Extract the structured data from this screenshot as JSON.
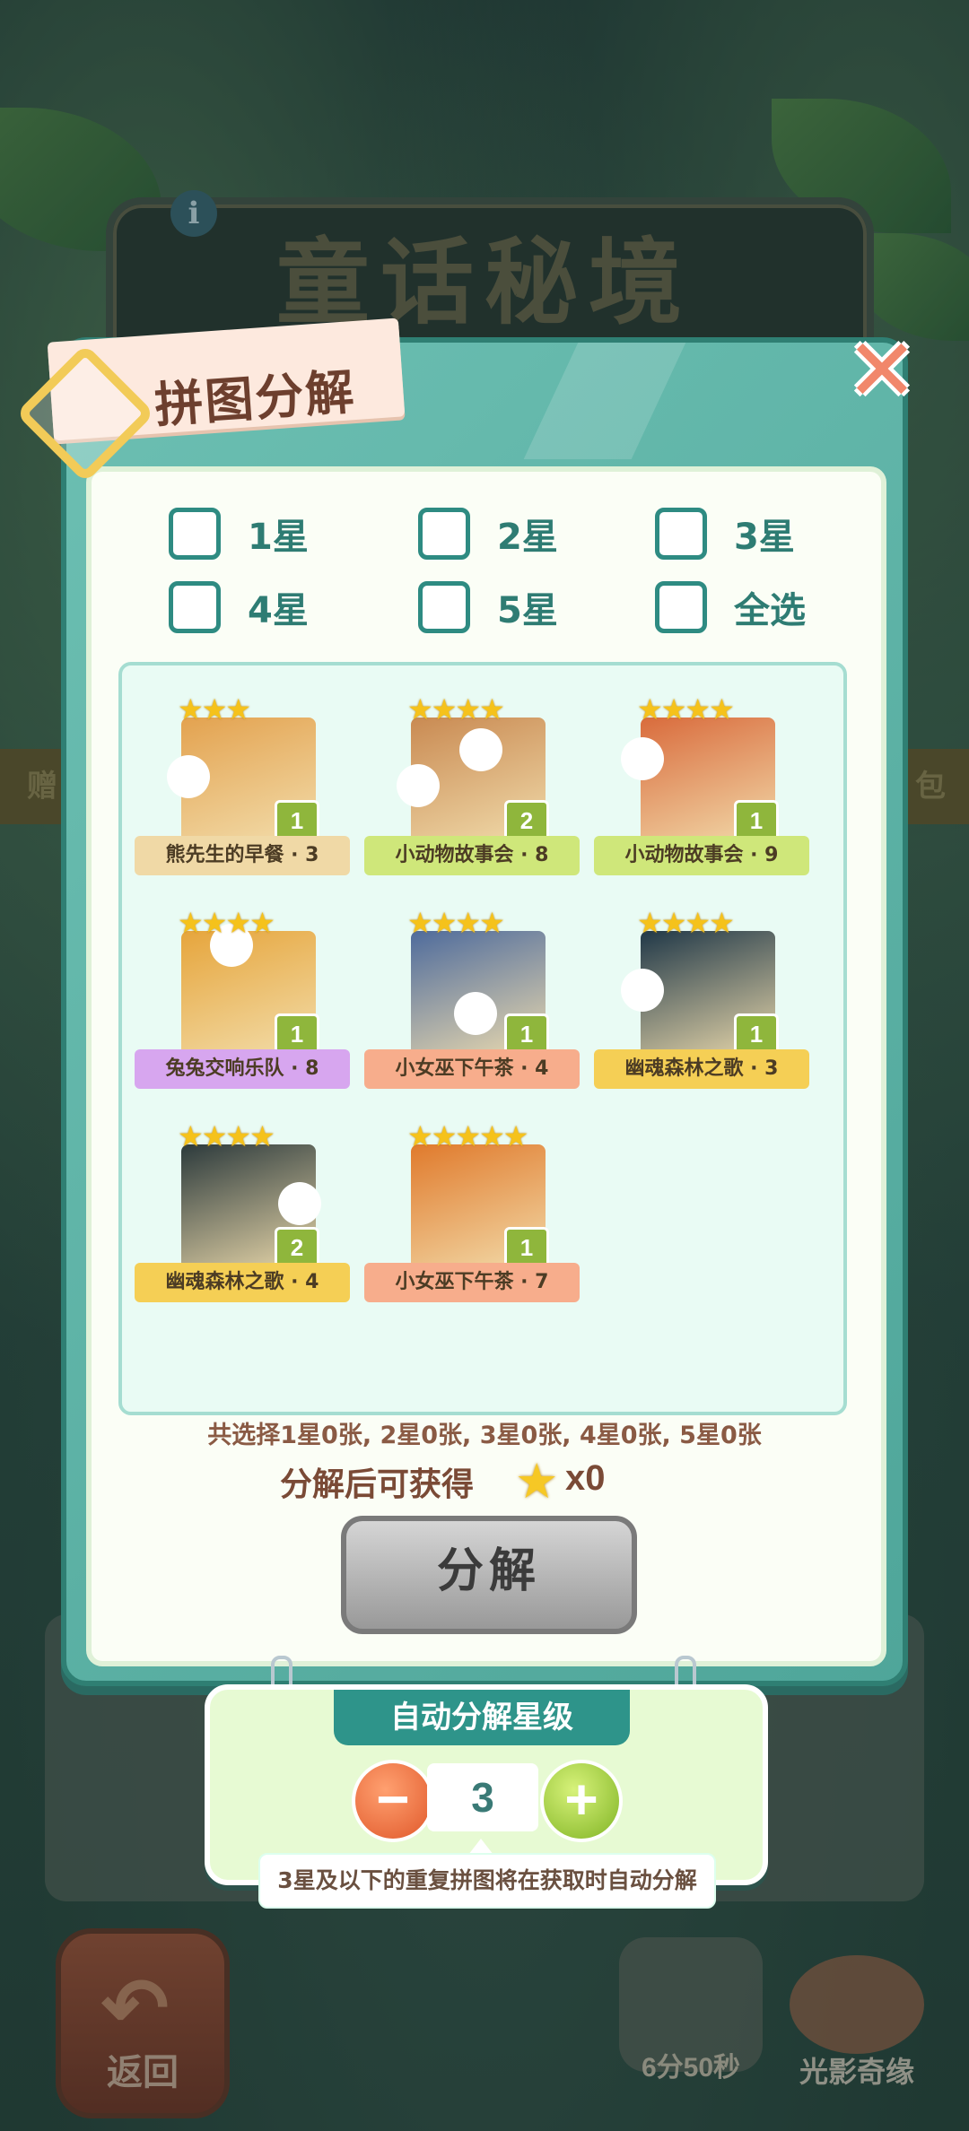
{
  "background": {
    "title": "童话秘境",
    "side_left": "赠",
    "side_right": "包",
    "back_label": "返回",
    "timer": "6分50秒",
    "light_shadow": "光影奇缘"
  },
  "dialog": {
    "title": "拼图分解",
    "close_icon": "close-icon",
    "filters": [
      "1星",
      "2星",
      "3星",
      "4星",
      "5星",
      "全选"
    ],
    "cards": [
      {
        "stars": "★★★",
        "count": "1",
        "label": "熊先生的早餐 · 3",
        "ribbon": "#f0d9a6",
        "img": "#e3a24f"
      },
      {
        "stars": "★★★★",
        "count": "2",
        "label": "小动物故事会 · 8",
        "ribbon": "#cfe77a",
        "img": "#c98a52"
      },
      {
        "stars": "★★★★",
        "count": "1",
        "label": "小动物故事会 · 9",
        "ribbon": "#cfe77a",
        "img": "#d96b3c"
      },
      {
        "stars": "★★★★",
        "count": "1",
        "label": "兔兔交响乐队 · 8",
        "ribbon": "#d7a6ef",
        "img": "#e6a53c"
      },
      {
        "stars": "★★★★",
        "count": "1",
        "label": "小女巫下午茶 · 4",
        "ribbon": "#f7ad8c",
        "img": "#4e6b9c"
      },
      {
        "stars": "★★★★",
        "count": "1",
        "label": "幽魂森林之歌 · 3",
        "ribbon": "#f5cf55",
        "img": "#203848"
      },
      {
        "stars": "★★★★",
        "count": "2",
        "label": "幽魂森林之歌 · 4",
        "ribbon": "#f5cf55",
        "img": "#2c3a3c"
      },
      {
        "stars": "★★★★★",
        "count": "1",
        "label": "小女巫下午茶 · 7",
        "ribbon": "#f7ad8c",
        "img": "#e07a2c"
      }
    ],
    "summary": "共选择1星0张, 2星0张, 3星0张, 4星0张, 5星0张",
    "reward_label": "分解后可获得",
    "reward_count": "x0",
    "decompose_button": "分解"
  },
  "auto": {
    "title": "自动分解星级",
    "minus": "−",
    "plus": "+",
    "level": "3",
    "tip": "3星及以下的重复拼图将在获取时自动分解"
  }
}
